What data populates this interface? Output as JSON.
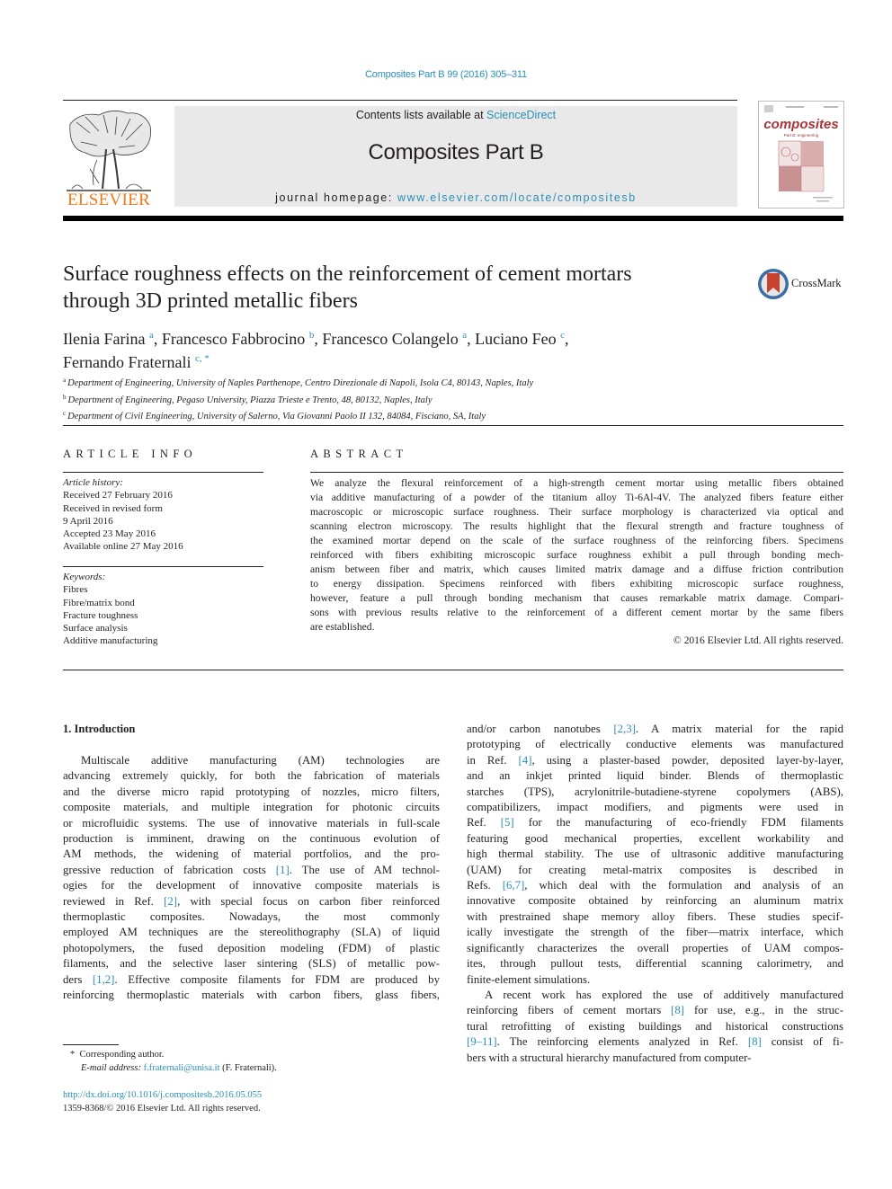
{
  "header": {
    "journal_ref": "Composites Part B 99 (2016) 305–311",
    "contents_prefix": "Contents lists available at ",
    "contents_link": "ScienceDirect",
    "journal_name": "Composites Part B",
    "homepage_prefix": "journal homepage: ",
    "homepage_link": "www.elsevier.com/locate/compositesb",
    "publisher_logo_text": "ELSEVIER",
    "cover_title": "composites",
    "cover_subtitle": "Part B: engineering",
    "crossmark_label": "CrossMark"
  },
  "article": {
    "title_lines": [
      "Surface roughness effects on the reinforcement of cement mortars",
      "through 3D printed metallic fibers"
    ],
    "authors": [
      {
        "name": "Ilenia Farina",
        "aff": "a",
        "sep": ", "
      },
      {
        "name": "Francesco Fabbrocino",
        "aff": "b",
        "sep": ", "
      },
      {
        "name": "Francesco Colangelo",
        "aff": "a",
        "sep": ", "
      },
      {
        "name": "Luciano Feo",
        "aff": "c",
        "sep": ","
      },
      {
        "name": "Fernando Fraternali",
        "aff": "c, *",
        "sep": ""
      }
    ],
    "affiliations": [
      {
        "key": "a",
        "text": "Department of Engineering, University of Naples Parthenope, Centro Direzionale di Napoli, Isola C4, 80143, Naples, Italy"
      },
      {
        "key": "b",
        "text": "Department of Engineering, Pegaso University, Piazza Trieste e Trento, 48, 80132, Naples, Italy"
      },
      {
        "key": "c",
        "text": "Department of Civil Engineering, University of Salerno, Via Giovanni Paolo II 132, 84084, Fisciano, SA, Italy"
      }
    ]
  },
  "article_info": {
    "heading": "ARTICLE INFO",
    "history_label": "Article history:",
    "history": [
      "Received 27 February 2016",
      "Received in revised form",
      "9 April 2016",
      "Accepted 23 May 2016",
      "Available online 27 May 2016"
    ],
    "keywords_label": "Keywords:",
    "keywords": [
      "Fibres",
      "Fibre/matrix bond",
      "Fracture toughness",
      "Surface analysis",
      "Additive manufacturing"
    ]
  },
  "abstract": {
    "heading": "ABSTRACT",
    "lines": [
      "We analyze the flexural reinforcement of a high-strength cement mortar using metallic fibers obtained",
      "via additive manufacturing of a powder of the titanium alloy Ti-6Al-4V. The analyzed fibers feature either",
      "macroscopic or microscopic surface roughness. Their surface morphology is characterized via optical and",
      "scanning electron microscopy. The results highlight that the flexural strength and fracture toughness of",
      "the examined mortar depend on the scale of the surface roughness of the reinforcing fibers. Specimens",
      "reinforced with fibers exhibiting microscopic surface roughness exhibit a pull through bonding mech-",
      "anism between fiber and matrix, which causes limited matrix damage and a diffuse friction contribution",
      "to energy dissipation. Specimens reinforced with fibers exhibiting microscopic surface roughness,",
      "however, feature a pull through bonding mechanism that causes remarkable matrix damage. Compari-",
      "sons with previous results relative to the reinforcement of a different cement mortar by the same fibers",
      "are established."
    ],
    "copyright": "© 2016 Elsevier Ltd. All rights reserved."
  },
  "body": {
    "section_heading": "1.  Introduction",
    "left_column": [
      [
        {
          "t": "Multiscale additive manufacturing (AM) technologies are"
        }
      ],
      [
        {
          "t": "advancing extremely quickly, for both the fabrication of materials"
        }
      ],
      [
        {
          "t": "and the diverse micro rapid prototyping of nozzles, micro filters,"
        }
      ],
      [
        {
          "t": "composite materials, and multiple integration for photonic circuits"
        }
      ],
      [
        {
          "t": "or microfluidic systems. The use of innovative materials in full-scale"
        }
      ],
      [
        {
          "t": "production is imminent, drawing on the continuous evolution of"
        }
      ],
      [
        {
          "t": "AM methods, the widening of material portfolios, and the pro-"
        }
      ],
      [
        {
          "t": "gressive reduction of fabrication costs "
        },
        {
          "t": "[1]",
          "ref": true
        },
        {
          "t": ". The use of AM technol-"
        }
      ],
      [
        {
          "t": "ogies for the development of innovative composite materials is"
        }
      ],
      [
        {
          "t": "reviewed in Ref. "
        },
        {
          "t": "[2]",
          "ref": true
        },
        {
          "t": ", with special focus on carbon fiber reinforced"
        }
      ],
      [
        {
          "t": "thermoplastic composites. Nowadays, the most commonly"
        }
      ],
      [
        {
          "t": "employed AM techniques are the stereolithography (SLA) of liquid"
        }
      ],
      [
        {
          "t": "photopolymers, the fused deposition modeling (FDM) of plastic"
        }
      ],
      [
        {
          "t": "filaments, and the selective laser sintering (SLS) of metallic pow-"
        }
      ],
      [
        {
          "t": "ders "
        },
        {
          "t": "[1,2]",
          "ref": true
        },
        {
          "t": ". Effective composite filaments for FDM are produced by"
        }
      ],
      [
        {
          "t": "reinforcing thermoplastic materials with carbon fibers, glass fibers,"
        }
      ]
    ],
    "right_column": [
      [
        {
          "t": "and/or carbon nanotubes "
        },
        {
          "t": "[2,3]",
          "ref": true
        },
        {
          "t": ". A matrix material for the rapid"
        }
      ],
      [
        {
          "t": "prototyping of electrically conductive elements was manufactured"
        }
      ],
      [
        {
          "t": "in Ref. "
        },
        {
          "t": "[4]",
          "ref": true
        },
        {
          "t": ", using a plaster-based powder, deposited layer-by-layer,"
        }
      ],
      [
        {
          "t": "and an inkjet printed liquid binder. Blends of thermoplastic"
        }
      ],
      [
        {
          "t": "starches (TPS), acrylonitrile-butadiene-styrene copolymers (ABS),"
        }
      ],
      [
        {
          "t": "compatibilizers, impact modifiers, and pigments were used in"
        }
      ],
      [
        {
          "t": "Ref. "
        },
        {
          "t": "[5]",
          "ref": true
        },
        {
          "t": " for the manufacturing of eco-friendly FDM filaments"
        }
      ],
      [
        {
          "t": "featuring good mechanical properties, excellent workability and"
        }
      ],
      [
        {
          "t": "high thermal stability. The use of ultrasonic additive manufacturing"
        }
      ],
      [
        {
          "t": "(UAM) for creating metal-matrix composites is described in"
        }
      ],
      [
        {
          "t": "Refs. "
        },
        {
          "t": "[6,7]",
          "ref": true
        },
        {
          "t": ", which deal with the formulation and analysis of an"
        }
      ],
      [
        {
          "t": "innovative composite obtained by reinforcing an aluminum matrix"
        }
      ],
      [
        {
          "t": "with prestrained shape memory alloy fibers. These studies specif-"
        }
      ],
      [
        {
          "t": "ically investigate the strength of the fiber—matrix interface, which"
        }
      ],
      [
        {
          "t": "significantly characterizes the overall properties of UAM compos-"
        }
      ],
      [
        {
          "t": "ites, through pullout tests, differential scanning calorimetry, and"
        }
      ],
      [
        {
          "t": "finite-element simulations."
        }
      ],
      [
        {
          "t": "A recent work has explored the use of additively manufactured"
        }
      ],
      [
        {
          "t": "reinforcing fibers of cement mortars "
        },
        {
          "t": "[8]",
          "ref": true
        },
        {
          "t": " for use, e.g., in the struc-"
        }
      ],
      [
        {
          "t": "tural retrofitting of existing buildings and historical constructions"
        }
      ],
      [
        {
          "t": "[9–11]",
          "ref": true
        },
        {
          "t": ". The reinforcing elements analyzed in Ref. "
        },
        {
          "t": "[8]",
          "ref": true
        },
        {
          "t": " consist of fi-"
        }
      ],
      [
        {
          "t": "bers with a structural hierarchy manufactured from computer-"
        }
      ]
    ]
  },
  "footnotes": {
    "corresponding_marker": "*",
    "corresponding_text": "Corresponding author.",
    "email_label": "E-mail address:",
    "email": "f.fraternali@unisa.it",
    "email_suffix": " (F. Fraternali).",
    "doi": "http://dx.doi.org/10.1016/j.compositesb.2016.05.055",
    "issn_line": "1359-8368/© 2016 Elsevier Ltd. All rights reserved."
  },
  "colors": {
    "link": "#2a8fb8",
    "elsevier_orange": "#f07a1a",
    "banner_gray": "#e9e9e9",
    "cover_red": "#a8353a",
    "crossmark_red": "#c8432f",
    "crossmark_blue": "#3a6ea5"
  }
}
